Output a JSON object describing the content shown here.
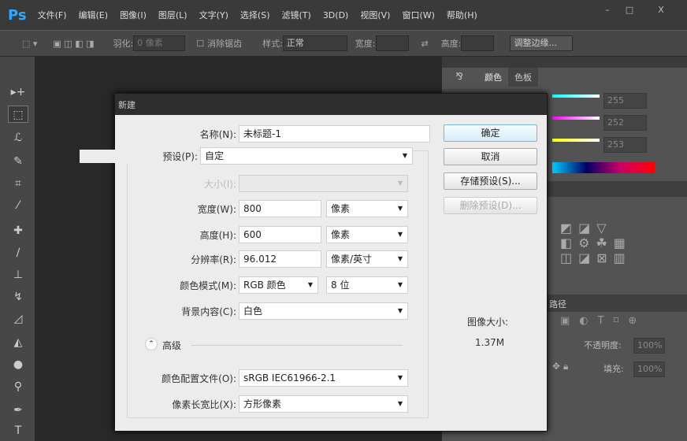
{
  "app": {
    "logo": "Ps",
    "menu": [
      "文件(F)",
      "编辑(E)",
      "图像(I)",
      "图层(L)",
      "文字(Y)",
      "选择(S)",
      "滤镜(T)",
      "3D(D)",
      "视图(V)",
      "窗口(W)",
      "帮助(H)"
    ],
    "window_controls": [
      "–",
      "□",
      "X"
    ]
  },
  "options": {
    "feather_label": "羽化:",
    "feather_value": "0 像素",
    "antialias_label": "消除锯齿",
    "style_label": "样式:",
    "style_value": "正常",
    "width_label": "宽度:",
    "height_label": "高度:",
    "refine_button": "调整边缘..."
  },
  "panels": {
    "tabs": [
      "颜色",
      "色板"
    ],
    "values": [
      "255",
      "252",
      "253"
    ],
    "paths_tab": "路径",
    "opacity_label": "不透明度:",
    "opacity_value": "100%",
    "fill_label": "填充:",
    "fill_value": "100%"
  },
  "dialog": {
    "title": "新建",
    "name_label": "名称(N):",
    "name_value": "未标题-1",
    "preset_label": "预设(P):",
    "preset_value": "自定",
    "size_label": "大小(I):",
    "width_label": "宽度(W):",
    "width_value": "800",
    "width_unit": "像素",
    "height_label": "高度(H):",
    "height_value": "600",
    "height_unit": "像素",
    "res_label": "分辨率(R):",
    "res_value": "96.012",
    "res_unit": "像素/英寸",
    "mode_label": "颜色模式(M):",
    "mode_value": "RGB 颜色",
    "depth_value": "8 位",
    "bg_label": "背景内容(C):",
    "bg_value": "白色",
    "advanced_label": "高级",
    "profile_label": "颜色配置文件(O):",
    "profile_value": "sRGB IEC61966-2.1",
    "aspect_label": "像素长宽比(X):",
    "aspect_value": "方形像素",
    "ok": "确定",
    "cancel": "取消",
    "save_preset": "存储预设(S)...",
    "delete_preset": "删除预设(D)...",
    "image_size_label": "图像大小:",
    "image_size_value": "1.37M"
  }
}
